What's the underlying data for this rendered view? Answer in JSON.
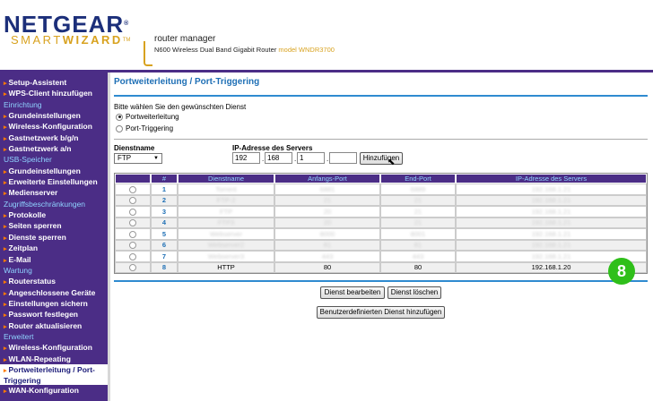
{
  "header": {
    "brand": "NETGEAR",
    "brand_tm": "®",
    "sub_brand_a": "SMART",
    "sub_brand_b": "WIZARD",
    "sub_brand_tm": "TM",
    "product": "router manager",
    "model_desc": "N600 Wireless Dual Band Gigabit Router",
    "model_label": "model WNDR3700"
  },
  "sidebar": {
    "items": [
      {
        "type": "item",
        "label": "Setup-Assistent"
      },
      {
        "type": "item",
        "label": "WPS-Client hinzufügen"
      },
      {
        "type": "section",
        "label": "Einrichtung"
      },
      {
        "type": "item",
        "label": "Grundeinstellungen"
      },
      {
        "type": "item",
        "label": "Wireless-Konfiguration"
      },
      {
        "type": "item",
        "label": "Gastnetzwerk b/g/n"
      },
      {
        "type": "item",
        "label": "Gastnetzwerk a/n"
      },
      {
        "type": "section",
        "label": "USB-Speicher"
      },
      {
        "type": "item",
        "label": "Grundeinstellungen"
      },
      {
        "type": "item",
        "label": "Erweiterte Einstellungen"
      },
      {
        "type": "item",
        "label": "Medienserver"
      },
      {
        "type": "section",
        "label": "Zugriffsbeschränkungen"
      },
      {
        "type": "item",
        "label": "Protokolle"
      },
      {
        "type": "item",
        "label": "Seiten sperren"
      },
      {
        "type": "item",
        "label": "Dienste sperren"
      },
      {
        "type": "item",
        "label": "Zeitplan"
      },
      {
        "type": "item",
        "label": "E-Mail"
      },
      {
        "type": "section",
        "label": "Wartung"
      },
      {
        "type": "item",
        "label": "Routerstatus"
      },
      {
        "type": "item",
        "label": "Angeschlossene Geräte"
      },
      {
        "type": "item",
        "label": "Einstellungen sichern"
      },
      {
        "type": "item",
        "label": "Passwort festlegen"
      },
      {
        "type": "item",
        "label": "Router aktualisieren"
      },
      {
        "type": "section",
        "label": "Erweitert"
      },
      {
        "type": "item",
        "label": "Wireless-Konfiguration"
      },
      {
        "type": "item",
        "label": "WLAN-Repeating"
      },
      {
        "type": "item",
        "label": "Portweiterleitung / Port-Triggering",
        "active": true,
        "two_line": true
      },
      {
        "type": "item",
        "label": "WAN-Konfiguration"
      }
    ]
  },
  "main": {
    "title": "Portweiterleitung / Port-Triggering",
    "prompt": "Bitte wählen Sie den gewünschten Dienst",
    "radio_forwarding": "Portweiterleitung",
    "radio_triggering": "Port-Triggering",
    "service_label": "Dienstname",
    "service_value": "FTP",
    "ip_label": "IP-Adresse des Servers",
    "ip": [
      "192",
      "168",
      "1",
      ""
    ],
    "add_button": "Hinzufügen",
    "table": {
      "headers": [
        "#",
        "Dienstname",
        "Anfangs-Port",
        "End-Port",
        "IP-Adresse des Servers"
      ],
      "rows": [
        {
          "n": "1",
          "name": "Torrent",
          "start": "6881",
          "end": "6889",
          "ip": "192.168.1.21",
          "blur": true
        },
        {
          "n": "2",
          "name": "FTP-2",
          "start": "21",
          "end": "21",
          "ip": "192.168.1.21",
          "blur": true
        },
        {
          "n": "3",
          "name": "FTP",
          "start": "20",
          "end": "21",
          "ip": "192.168.1.21",
          "blur": true
        },
        {
          "n": "4",
          "name": "FTP3",
          "start": "20",
          "end": "21",
          "ip": "192.168.1.21",
          "blur": true
        },
        {
          "n": "5",
          "name": "Webserver",
          "start": "8000",
          "end": "8001",
          "ip": "192.168.1.21",
          "blur": true
        },
        {
          "n": "6",
          "name": "Webserver2",
          "start": "81",
          "end": "81",
          "ip": "192.168.1.21",
          "blur": true
        },
        {
          "n": "7",
          "name": "Webserver3",
          "start": "443",
          "end": "443",
          "ip": "192.168.1.21",
          "blur": true
        },
        {
          "n": "8",
          "name": "HTTP",
          "start": "80",
          "end": "80",
          "ip": "192.168.1.20",
          "blur": false
        }
      ]
    },
    "edit_button": "Dienst bearbeiten",
    "delete_button": "Dienst löschen",
    "custom_button": "Benutzerdefinierten Dienst hinzufügen"
  },
  "step_badge": "8",
  "colors": {
    "brand_blue": "#1c2f7a",
    "brand_gold": "#d8a21f",
    "sidebar_purple": "#4b2d86",
    "title_blue": "#1e6fb5",
    "badge_green": "#2fbf1a"
  }
}
